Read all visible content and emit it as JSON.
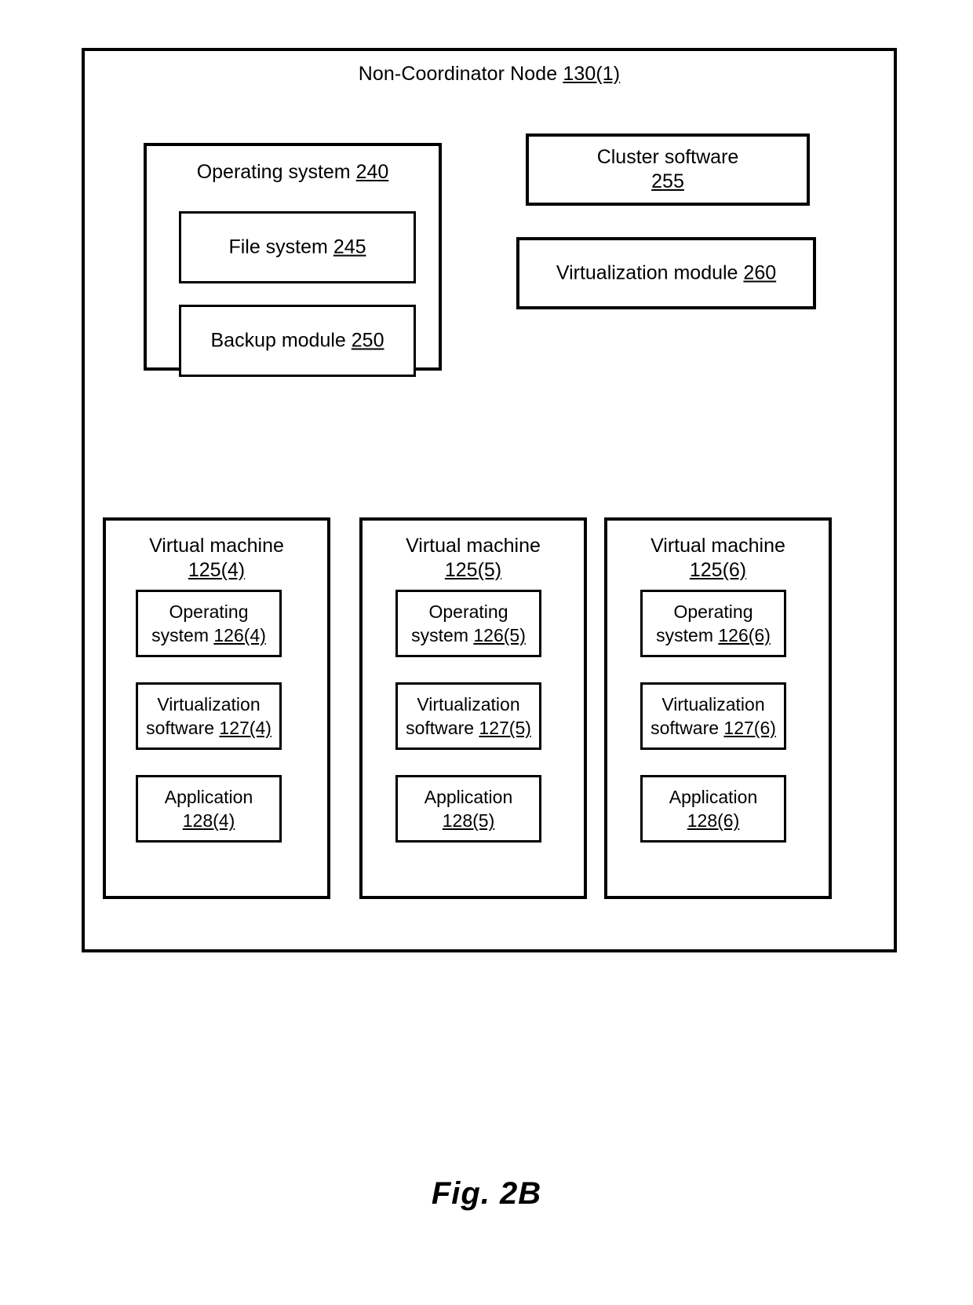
{
  "figure": {
    "caption": "Fig. 2B"
  },
  "node": {
    "title_text": "Non-Coordinator Node",
    "title_ref": "130(1)"
  },
  "operating_system": {
    "label_text": "Operating system",
    "label_ref": "240",
    "children": [
      {
        "name": "file-system",
        "label_text": "File system",
        "label_ref": "245"
      },
      {
        "name": "backup-module",
        "label_text": "Backup module",
        "label_ref": "250"
      }
    ]
  },
  "cluster_software": {
    "label_text": "Cluster software",
    "label_ref": "255"
  },
  "virtualization_module": {
    "label_text": "Virtualization module",
    "label_ref": "260"
  },
  "virtual_machines": [
    {
      "title_text": "Virtual machine",
      "title_ref": "125(4)",
      "os_line1": "Operating",
      "os_line2_text": "system",
      "os_line2_ref": "126(4)",
      "virt_line1": "Virtualization",
      "virt_line2_text": "software",
      "virt_line2_ref": "127(4)",
      "app_line1": "Application",
      "app_line2_ref": "128(4)"
    },
    {
      "title_text": "Virtual machine",
      "title_ref": "125(5)",
      "os_line1": "Operating",
      "os_line2_text": "system",
      "os_line2_ref": "126(5)",
      "virt_line1": "Virtualization",
      "virt_line2_text": "software",
      "virt_line2_ref": "127(5)",
      "app_line1": "Application",
      "app_line2_ref": "128(5)"
    },
    {
      "title_text": "Virtual machine",
      "title_ref": "125(6)",
      "os_line1": "Operating",
      "os_line2_text": "system",
      "os_line2_ref": "126(6)",
      "virt_line1": "Virtualization",
      "virt_line2_text": "software",
      "virt_line2_ref": "127(6)",
      "app_line1": "Application",
      "app_line2_ref": "128(6)"
    }
  ],
  "colors": {
    "stroke": "#000000",
    "background": "#ffffff"
  }
}
